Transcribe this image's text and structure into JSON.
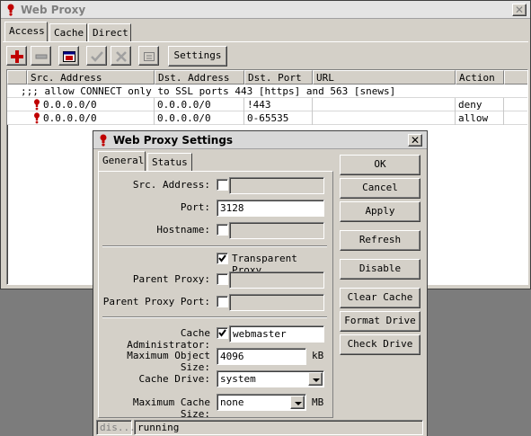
{
  "main_window": {
    "title": "Web Proxy",
    "tabs": [
      {
        "label": "Access"
      },
      {
        "label": "Cache"
      },
      {
        "label": "Direct"
      }
    ],
    "settings_label": "Settings",
    "columns": [
      "Src. Address",
      "Dst. Address",
      "Dst. Port",
      "URL",
      "Action"
    ],
    "comment": ";;; allow CONNECT only to SSL ports 443 [https] and 563 [snews]",
    "rows": [
      {
        "src": "0.0.0.0/0",
        "dst": "0.0.0.0/0",
        "port": "!443",
        "url": "",
        "action": "deny"
      },
      {
        "src": "0.0.0.0/0",
        "dst": "0.0.0.0/0",
        "port": "0-65535",
        "url": "",
        "action": "allow"
      }
    ]
  },
  "dialog": {
    "title": "Web Proxy Settings",
    "tabs": [
      {
        "label": "General"
      },
      {
        "label": "Status"
      }
    ],
    "labels": {
      "src_address": "Src. Address:",
      "port": "Port:",
      "hostname": "Hostname:",
      "transparent": "Transparent Proxy",
      "parent_proxy": "Parent Proxy:",
      "parent_proxy_port": "Parent Proxy Port:",
      "cache_admin": "Cache Administrator:",
      "max_object": "Maximum Object Size:",
      "cache_drive": "Cache Drive:",
      "max_cache": "Maximum Cache Size:"
    },
    "values": {
      "src_address": "",
      "port": "3128",
      "hostname": "",
      "parent_proxy": "",
      "parent_proxy_port": "",
      "cache_admin": "webmaster",
      "max_object": "4096",
      "cache_drive": "system",
      "max_cache": "none"
    },
    "checks": {
      "src_address": false,
      "hostname": false,
      "transparent": true,
      "parent_proxy": false,
      "parent_proxy_port": false,
      "cache_admin": true
    },
    "units": {
      "kb": "kB",
      "mb": "MB"
    },
    "buttons": {
      "ok": "OK",
      "cancel": "Cancel",
      "apply": "Apply",
      "refresh": "Refresh",
      "disable": "Disable",
      "clear_cache": "Clear Cache",
      "format_drive": "Format Drive",
      "check_drive": "Check Drive"
    },
    "status_bar": {
      "left": "dis...",
      "right": "running"
    }
  },
  "colors": {
    "accent_red": "#c00000"
  }
}
